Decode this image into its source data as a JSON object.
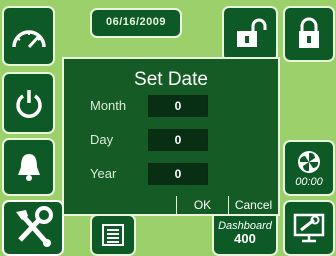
{
  "header": {
    "date": "06/16/2009"
  },
  "sidebar_right": {
    "fan_time": "00:00"
  },
  "footer": {
    "dashboard_label": "Dashboard",
    "dashboard_value": "400"
  },
  "dialog": {
    "title": "Set Date",
    "fields": [
      {
        "label": "Month",
        "value": "0"
      },
      {
        "label": "Day",
        "value": "0"
      },
      {
        "label": "Year",
        "value": "0"
      }
    ],
    "ok_label": "OK",
    "cancel_label": "Cancel"
  },
  "icons": [
    "gauge-icon",
    "power-icon",
    "bell-icon",
    "tools-icon",
    "lock-icon",
    "unlock-icon",
    "fan-icon",
    "wrench-monitor-icon",
    "list-icon"
  ],
  "colors": {
    "background": "#9bd06b",
    "tile": "#0d5a26",
    "dialog": "#155b25",
    "input": "#082f14",
    "border": "#e9f5da"
  }
}
